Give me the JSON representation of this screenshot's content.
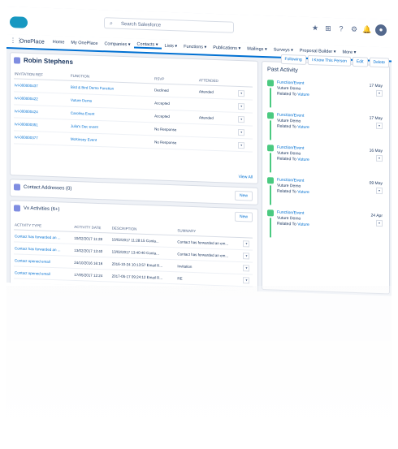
{
  "header": {
    "search_placeholder": "Search Salesforce",
    "icons": [
      "star-icon",
      "add-icon",
      "help-icon",
      "gear-icon",
      "bell-icon",
      "avatar"
    ]
  },
  "nav": {
    "app": "OnePlace",
    "tabs": [
      {
        "label": "Home"
      },
      {
        "label": "My OnePlace"
      },
      {
        "label": "Companies ▾"
      },
      {
        "label": "Contacts ▾",
        "active": true
      },
      {
        "label": "Lists ▾"
      },
      {
        "label": "Functions ▾"
      },
      {
        "label": "Publications ▾"
      },
      {
        "label": "Mailings ▾"
      },
      {
        "label": "Surveys ▾"
      },
      {
        "label": "Proposal Builder ▾"
      },
      {
        "label": "More ▾"
      }
    ]
  },
  "record": {
    "name": "Robin Stephens",
    "buttons": [
      "Following",
      "I Know This Person",
      "Edit",
      "Delete"
    ]
  },
  "events": {
    "headers": [
      "INVITATION REF",
      "FUNCTION",
      "RSVP",
      "ATTENDED"
    ],
    "rows": [
      {
        "ref": "IvI-000000437",
        "function": "Bird & Bird Demo Function",
        "rsvp": "Declined",
        "attended": "Attended"
      },
      {
        "ref": "IvI-000000422",
        "function": "Vuture Demo",
        "rsvp": "Accepted",
        "attended": ""
      },
      {
        "ref": "IvI-000000424",
        "function": "Carolina Event",
        "rsvp": "Accepted",
        "attended": "Attended"
      },
      {
        "ref": "IvI-000000351",
        "function": "Julia's Dec event",
        "rsvp": "No Response",
        "attended": ""
      },
      {
        "ref": "IvI-000000377",
        "function": "McKinsey Event",
        "rsvp": "No Response",
        "attended": ""
      }
    ],
    "view_all": "View All"
  },
  "addresses": {
    "title": "Contact Addresses (0)",
    "button": "New"
  },
  "activities": {
    "title": "Vx Activities (6+)",
    "button": "New",
    "headers": [
      "ACTIVITY TYPE",
      "ACTIVITY DATE",
      "DESCRIPTION",
      "SUMMARY"
    ],
    "rows": [
      {
        "type": "Contact has forwarded an ...",
        "date": "10/02/2017 11:28",
        "desc": "10/02/2017 11:28:15 Conta...",
        "summary": "Contact has forwarded an em..."
      },
      {
        "type": "Contact has forwarded an ...",
        "date": "13/02/2017 13:40",
        "desc": "13/02/2017 13:40:40 Conta...",
        "summary": "Contact has forwarded an em..."
      },
      {
        "type": "Contact opened email",
        "date": "24/10/2016 16:16",
        "desc": "2016-10-24 10:13:57 Email R...",
        "summary": "Invitation"
      },
      {
        "type": "Contact opened email",
        "date": "17/05/2017 12:24",
        "desc": "2017-05-17 09:24:12 Email R...",
        "summary": "RE"
      }
    ]
  },
  "past_activity": {
    "title": "Past Activity",
    "items": [
      {
        "type": "Function/Event",
        "subject": "Vuture Demo",
        "related_label": "Related To",
        "related": "Vuture",
        "date": "17 May"
      },
      {
        "type": "Function/Event",
        "subject": "Vuture Demo",
        "related_label": "Related To",
        "related": "Vuture",
        "date": "17 May"
      },
      {
        "type": "Function/Event",
        "subject": "Vuture Demo",
        "related_label": "Related To",
        "related": "Vuture",
        "date": "16 May"
      },
      {
        "type": "Function/Event",
        "subject": "Vuture Demo",
        "related_label": "Related To",
        "related": "Vuture",
        "date": "09 May"
      },
      {
        "type": "Function/Event",
        "subject": "Vuture Demo",
        "related_label": "Related To",
        "related": "Vuture",
        "date": "24 Apr"
      }
    ]
  }
}
